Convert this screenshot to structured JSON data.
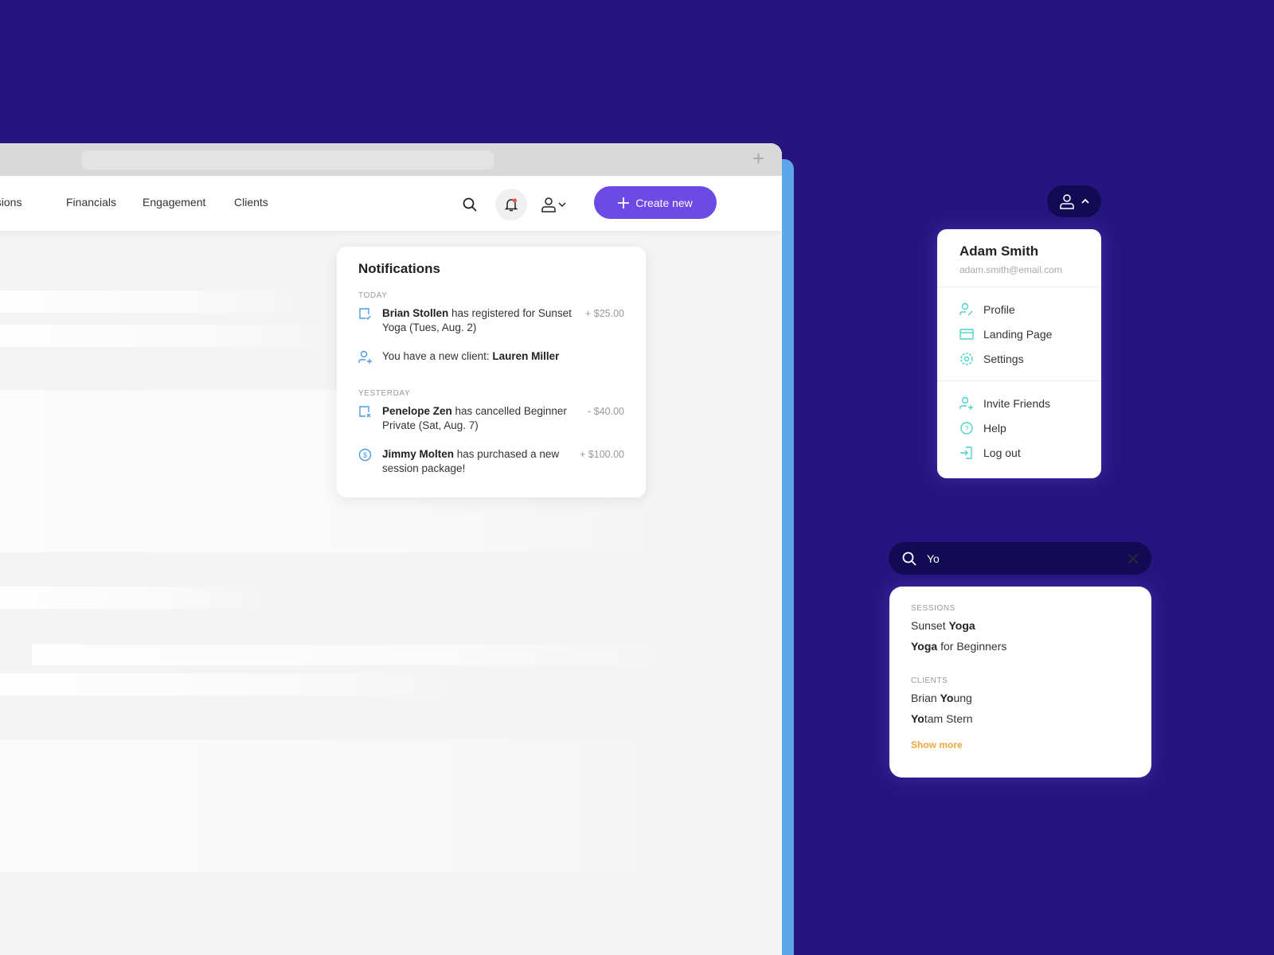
{
  "colors": {
    "background": "#27157f",
    "accent": "#6c4ae6",
    "menu_icon": "#4fd1c8",
    "notif_icon": "#4a9be8",
    "show_more": "#f3a53a"
  },
  "nav": {
    "links": [
      "essions",
      "Financials",
      "Engagement",
      "Clients"
    ],
    "create_label": "Create new"
  },
  "notifications": {
    "title": "Notifications",
    "today_label": "TODAY",
    "yesterday_label": "YESTERDAY",
    "items": [
      {
        "icon": "calendar-check-icon",
        "bold": "Brian Stollen",
        "text": " has registered for Sunset Yoga (Tues, Aug. 2)",
        "amount": "+ $25.00"
      },
      {
        "icon": "user-plus-icon",
        "pre": "You have a new client: ",
        "bold": "Lauren Miller"
      },
      {
        "icon": "calendar-x-icon",
        "bold": "Penelope Zen",
        "text": " has cancelled Beginner Private (Sat, Aug. 7)",
        "amount": "- $40.00"
      },
      {
        "icon": "dollar-circle-icon",
        "bold": "Jimmy Molten",
        "text": " has purchased a new session package!",
        "amount": "+ $100.00"
      }
    ]
  },
  "user_menu": {
    "name": "Adam Smith",
    "email": "adam.smith@email.com",
    "items": [
      "Profile",
      "Landing Page",
      "Settings",
      "Invite Friends",
      "Help",
      "Log out"
    ]
  },
  "search": {
    "value": "Yo",
    "sessions_label": "SESSIONS",
    "clients_label": "CLIENTS",
    "sessions": [
      {
        "pre": "Sunset ",
        "match": "Yoga",
        "post": ""
      },
      {
        "pre": "",
        "match": "Yoga",
        "post": " for Beginners"
      }
    ],
    "clients": [
      {
        "pre": "Brian ",
        "match": "Yo",
        "post": "ung"
      },
      {
        "pre": "",
        "match": "Yo",
        "post": "tam Stern"
      }
    ],
    "show_more": "Show more"
  }
}
